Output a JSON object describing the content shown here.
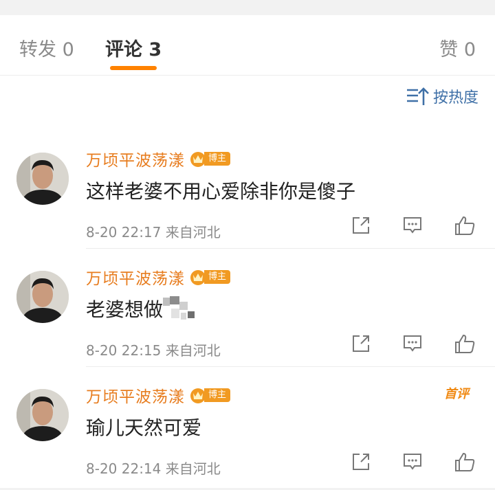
{
  "tabs": {
    "repost": "转发 0",
    "comment": "评论 3",
    "like": "赞 0"
  },
  "sort": {
    "label": "按热度",
    "icon": "sort-icon"
  },
  "badge_text": "博主",
  "comments": [
    {
      "name": "万顷平波荡漾",
      "content": "这样老婆不用心爱除非你是傻子",
      "meta": "8-20 22:17  来自河北",
      "first": ""
    },
    {
      "name": "万顷平波荡漾",
      "content": "老婆想做",
      "meta": "8-20 22:15  来自河北",
      "first": ""
    },
    {
      "name": "万顷平波荡漾",
      "content": "瑜儿天然可爱",
      "meta": "8-20 22:14  来自河北",
      "first": "首评"
    }
  ],
  "colors": {
    "accent": "#ff8200",
    "name": "#e77c1e",
    "link": "#3f70a7"
  }
}
